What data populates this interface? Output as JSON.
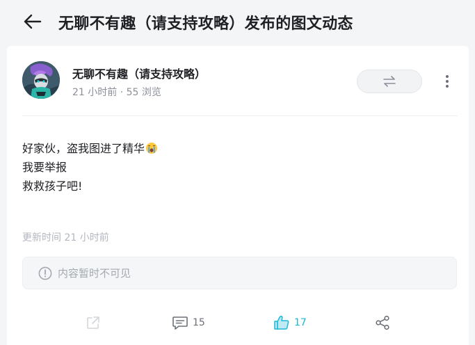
{
  "header": {
    "title": "无聊不有趣（请支持攻略）发布的图文动态"
  },
  "author": {
    "name": "无聊不有趣（请支持攻略）",
    "time": "21 小时前",
    "separator": " · ",
    "views": "55 浏览"
  },
  "post": {
    "lines": [
      "好家伙，盗我图进了精华",
      "我要举报",
      "救救孩子吧!"
    ],
    "emoji": "crying-face"
  },
  "update_time": "更新时间 21 小时前",
  "notice": {
    "text": "内容暂时不可见"
  },
  "actions": {
    "comments": "15",
    "likes": "17"
  },
  "colors": {
    "accent": "#19b7d9",
    "text": "#1f2024",
    "muted": "#8a8f99",
    "background": "#f4f5f7"
  }
}
